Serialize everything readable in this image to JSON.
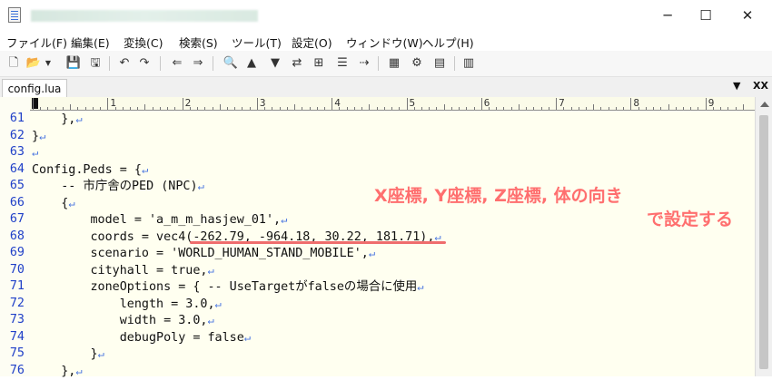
{
  "window": {
    "minimize_glyph": "─",
    "maximize_glyph": "☐",
    "close_glyph": "✕"
  },
  "menu": [
    "ファイル(F)",
    "編集(E)",
    "変換(C)",
    "検索(S)",
    "ツール(T)",
    "設定(O)",
    "ウィンドウ(W)",
    "ヘルプ(H)"
  ],
  "toolbar_icons": [
    "new-file-icon",
    "open-folder-icon",
    "save-icon",
    "save-all-icon",
    "undo-icon",
    "redo-icon",
    "back-icon",
    "forward-icon",
    "search-icon",
    "search-prev-icon",
    "search-next-icon",
    "replace-icon",
    "grep-icon",
    "outline-icon",
    "tag-jump-icon",
    "compare-icon",
    "settings-icon",
    "font-icon",
    "list-icon"
  ],
  "tab": {
    "label": "config.lua",
    "dropdown_glyph": "▼",
    "close_glyph": "XX"
  },
  "ruler": {
    "labels": [
      "1",
      "2",
      "3",
      "4",
      "5",
      "6",
      "7",
      "8",
      "9"
    ]
  },
  "code": {
    "return_glyph": "↵",
    "lines": [
      {
        "num": "61",
        "text": "    },",
        "ret": true
      },
      {
        "num": "62",
        "text": "}",
        "ret": true
      },
      {
        "num": "63",
        "text": "",
        "ret": true
      },
      {
        "num": "64",
        "text": "Config.Peds = {",
        "ret": true
      },
      {
        "num": "65",
        "text": "    -- 市庁舎のPED (NPC)",
        "ret": true
      },
      {
        "num": "66",
        "text": "    {",
        "ret": true
      },
      {
        "num": "67",
        "text": "        model = 'a_m_m_hasjew_01',",
        "ret": true
      },
      {
        "num": "68",
        "text": "        coords = vec4(-262.79, -964.18, 30.22, 181.71),",
        "ret": true
      },
      {
        "num": "69",
        "text": "        scenario = 'WORLD_HUMAN_STAND_MOBILE',",
        "ret": true
      },
      {
        "num": "70",
        "text": "        cityhall = true,",
        "ret": true
      },
      {
        "num": "71",
        "text": "        zoneOptions = { -- UseTargetがfalseの場合に使用",
        "ret": true
      },
      {
        "num": "72",
        "text": "            length = 3.0,",
        "ret": true
      },
      {
        "num": "73",
        "text": "            width = 3.0,",
        "ret": true
      },
      {
        "num": "74",
        "text": "            debugPoly = false",
        "ret": true
      },
      {
        "num": "75",
        "text": "        }",
        "ret": true
      },
      {
        "num": "76",
        "text": "    },",
        "ret": true
      }
    ]
  },
  "annotation": {
    "line1": "X座標, Y座標, Z座標, 体の向き",
    "line2": "で設定する",
    "color": "#ff6f6f"
  }
}
